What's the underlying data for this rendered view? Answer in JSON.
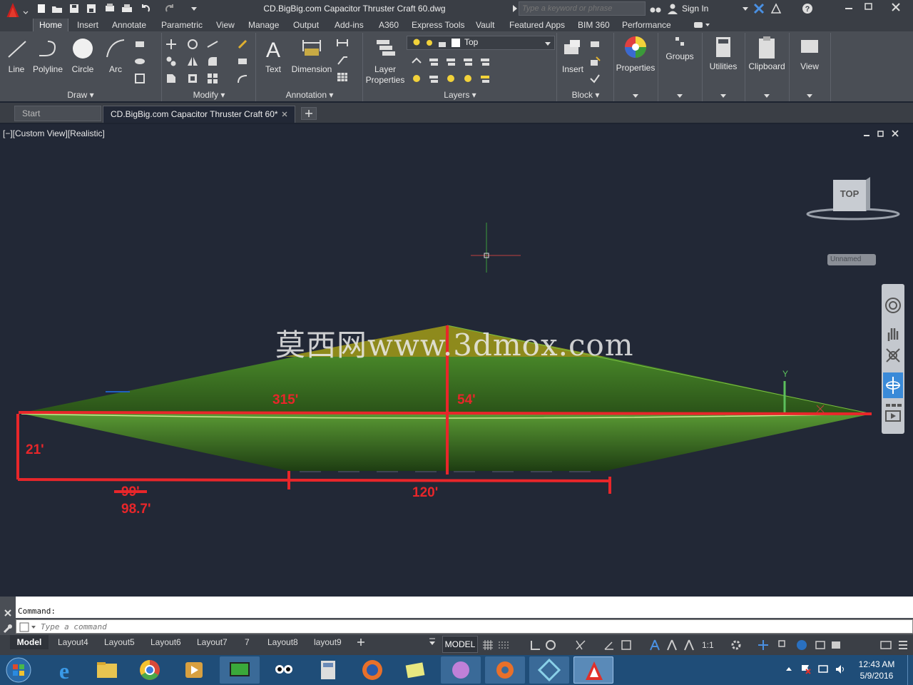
{
  "app": {
    "title": "CD.BigBig.com Capacitor Thruster Craft 60.dwg",
    "search_placeholder": "Type a keyword or phrase",
    "sign_in": "Sign In"
  },
  "ribbon_tabs": [
    "Home",
    "Insert",
    "Annotate",
    "Parametric",
    "View",
    "Manage",
    "Output",
    "Add-ins",
    "A360",
    "Express Tools",
    "Vault",
    "Featured Apps",
    "BIM 360",
    "Performance"
  ],
  "ribbon": {
    "draw": {
      "line": "Line",
      "polyline": "Polyline",
      "circle": "Circle",
      "arc": "Arc",
      "panel": "Draw"
    },
    "modify": {
      "panel": "Modify"
    },
    "annotation": {
      "text": "Text",
      "dimension": "Dimension",
      "panel": "Annotation"
    },
    "layers": {
      "layer_properties_1": "Layer",
      "layer_properties_2": "Properties",
      "current_layer": "Top",
      "panel": "Layers"
    },
    "block": {
      "insert": "Insert",
      "panel": "Block"
    },
    "properties": "Properties",
    "groups": "Groups",
    "utilities": "Utilities",
    "clipboard": "Clipboard",
    "view": "View"
  },
  "doc_tabs": {
    "start": "Start",
    "active": "CD.BigBig.com Capacitor Thruster Craft 60*"
  },
  "viewport": {
    "label": "[−][Custom View][Realistic]",
    "viewcube": "TOP",
    "ucs": "Unnamed",
    "watermark": "莫西网www.3dmox.com",
    "dims": {
      "length": "315'",
      "half_height": "54'",
      "bottom_height": "21'",
      "struck": "99'",
      "offset": "98.7'",
      "flat": "120'"
    },
    "axis_y": "Y",
    "axis_x": "X"
  },
  "command": {
    "label": "Command:",
    "placeholder": "Type a command"
  },
  "layout_tabs": [
    "Model",
    "Layout4",
    "Layout5",
    "Layout6",
    "Layout7",
    "7",
    "Layout8",
    "layout9"
  ],
  "status": {
    "model": "MODEL",
    "scale": "1:1"
  },
  "clock": {
    "time": "12:43 AM",
    "date": "5/9/2016"
  },
  "colors": {
    "accent": "#1e7ac9",
    "dimension_red": "#e8262a",
    "hull_green": "#3f7a22",
    "hull_yellow": "#8e8a1c"
  }
}
